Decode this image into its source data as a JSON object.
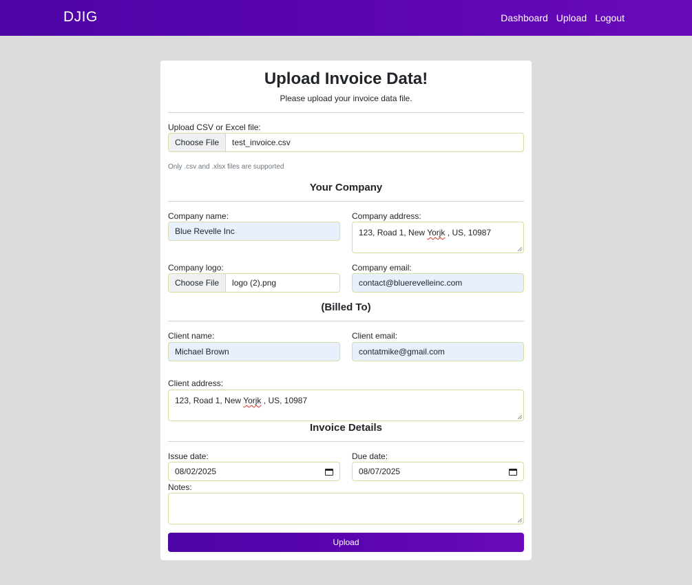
{
  "nav": {
    "brand": "DJIG",
    "links": [
      "Dashboard",
      "Upload",
      "Logout"
    ]
  },
  "colors": {
    "accent": "#5a04b0",
    "field_border": "#cfe0a0",
    "autofill_bg": "#e8f0fe"
  },
  "header": {
    "title": "Upload Invoice Data!",
    "subtitle": "Please upload your invoice data file."
  },
  "upload": {
    "label": "Upload CSV or Excel file:",
    "button": "Choose File",
    "file_name": "test_invoice.csv",
    "hint": "Only .csv and .xlsx files are supported"
  },
  "company": {
    "section": "Your Company",
    "name_label": "Company name:",
    "name_value": "Blue Revelle Inc",
    "address_label": "Company address:",
    "address_pre": "123, Road 1, New ",
    "address_misspelled": "Yorjk",
    "address_post": " , US, 10987",
    "logo_label": "Company logo:",
    "logo_button": "Choose File",
    "logo_file": "logo (2).png",
    "email_label": "Company email:",
    "email_value": "contact@bluerevelleinc.com"
  },
  "client": {
    "section": "(Billed To)",
    "name_label": "Client name:",
    "name_value": "Michael Brown",
    "email_label": "Client email:",
    "email_value": "contatmike@gmail.com",
    "address_label": "Client address:",
    "address_pre": "123, Road 1, New ",
    "address_misspelled": "Yorjk",
    "address_post": " , US, 10987"
  },
  "invoice": {
    "section": "Invoice Details",
    "issue_label": "Issue date:",
    "issue_value": "08/02/2025",
    "due_label": "Due date:",
    "due_value": "08/07/2025",
    "notes_label": "Notes:",
    "notes_value": ""
  },
  "submit": {
    "label": "Upload"
  }
}
